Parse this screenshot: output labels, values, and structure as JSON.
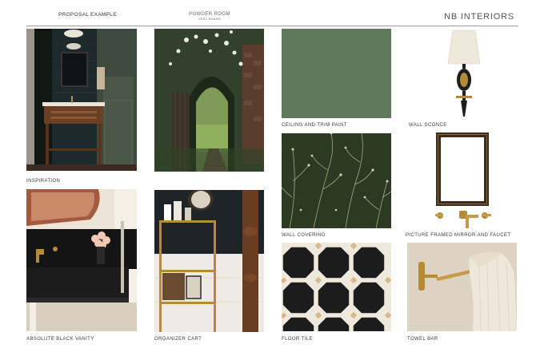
{
  "header": {
    "left": "PROPOSAL EXAMPLE",
    "middle_title": "POWDER ROOM",
    "middle_subtitle": "SPEC BOARD",
    "right": "NB INTERIORS"
  },
  "captions": {
    "inspiration": "INSPIRATION",
    "ceiling_paint": "CEILING AND TRIM PAINT",
    "wall_sconce": "WALL SCONCE",
    "wall_covering": "WALL COVERING",
    "mirror_faucet": "PICTURE FRAMED MIRROR AND FAUCET",
    "vanity": "ABSOLUTE BLACK VANITY",
    "cart": "ORGANIZER CART",
    "floor_tile": "FLOOR TILE",
    "towel_bar": "TOWEL BAR"
  },
  "colors": {
    "ceiling_paint_swatch": "#5e7a5a",
    "wallcovering_ground": "#2c3a24",
    "tile_black": "#1c1c1c",
    "tile_dot": "#d8b888",
    "brass": "#b58b3a"
  },
  "images": [
    {
      "name": "inspiration-photo",
      "depicts": "dark powder room with wood washstand"
    },
    {
      "name": "garden-gate-photo",
      "depicts": "arched garden gate with roses"
    },
    {
      "name": "wall-sconce-photo",
      "depicts": "brass and black sconce with white shade"
    },
    {
      "name": "wall-covering-swatch",
      "depicts": "dark green botanical wallpaper"
    },
    {
      "name": "mirror-photo",
      "depicts": "picture frame mirror"
    },
    {
      "name": "faucet-photo",
      "depicts": "brass wall mount faucet"
    },
    {
      "name": "vanity-photo",
      "depicts": "black stone vanity with brass faucet"
    },
    {
      "name": "cart-photo",
      "depicts": "brass organizer cart"
    },
    {
      "name": "floor-tile-photo",
      "depicts": "black octagon tile with tan dots"
    },
    {
      "name": "towel-bar-photo",
      "depicts": "brass towel bar with linen towel"
    }
  ]
}
